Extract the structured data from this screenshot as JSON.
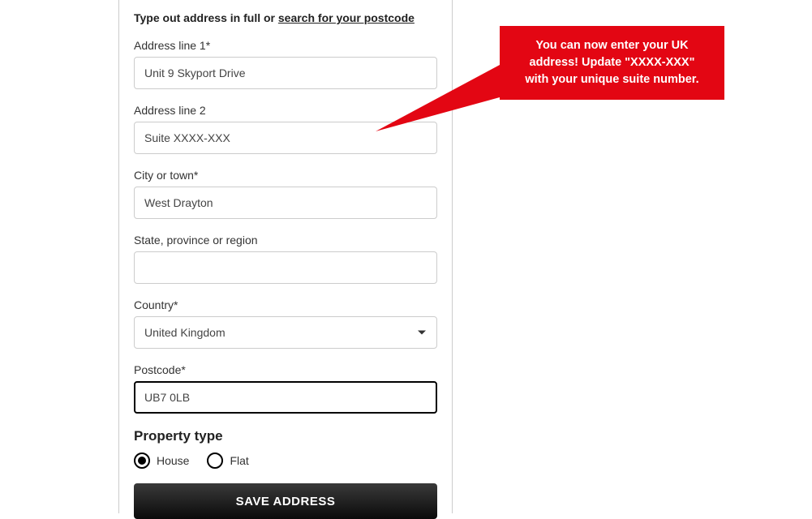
{
  "instruction": {
    "prefix": "Type out address in full or ",
    "link": "search for your postcode"
  },
  "fields": {
    "addr1": {
      "label": "Address line 1*",
      "value": "Unit 9 Skyport Drive"
    },
    "addr2": {
      "label": "Address line 2",
      "value": "Suite XXXX-XXX"
    },
    "city": {
      "label": "City or town*",
      "value": "West Drayton"
    },
    "state": {
      "label": "State, province or region",
      "value": ""
    },
    "country": {
      "label": "Country*",
      "value": "United Kingdom"
    },
    "postcode": {
      "label": "Postcode*",
      "value": "UB7 0LB"
    }
  },
  "propertyType": {
    "heading": "Property type",
    "options": {
      "house": "House",
      "flat": "Flat"
    },
    "selected": "house"
  },
  "saveButton": "SAVE ADDRESS",
  "callout": {
    "line1": "You can now enter your UK",
    "line2": "address! Update \"XXXX-XXX\"",
    "line3": "with your unique suite number."
  }
}
